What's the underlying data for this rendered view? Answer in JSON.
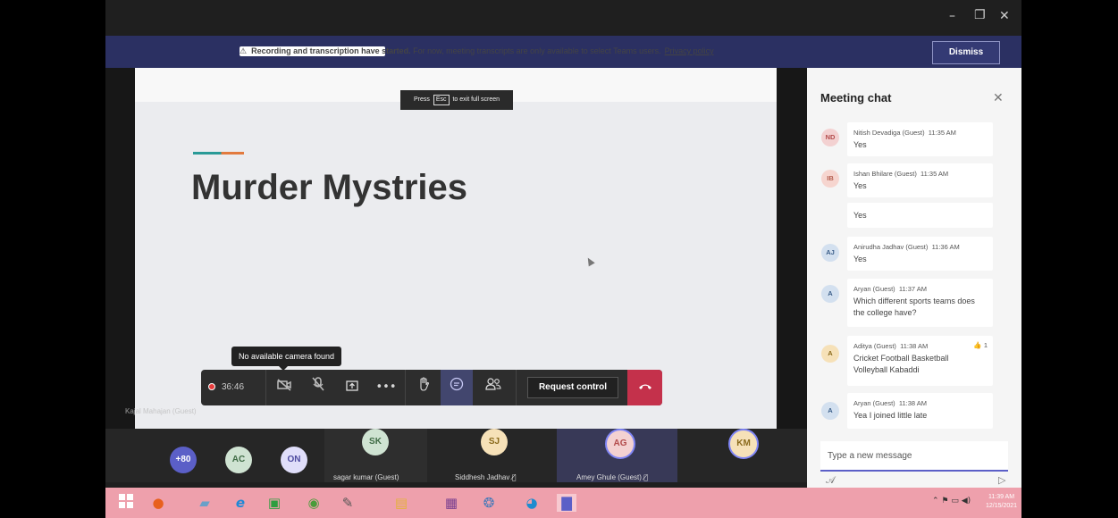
{
  "window": {
    "minimize_glyph": "–",
    "restore_glyph": "❐",
    "close_glyph": "✕"
  },
  "banner": {
    "warning_icon": "⚠",
    "bold_text": "Recording and transcription have started.",
    "text": " For now, meeting transcripts are only available to select Teams users.",
    "link_text": "Privacy policy",
    "dismiss_label": "Dismiss"
  },
  "fullscreen_tip": {
    "before": "Press",
    "key": "Esc",
    "after": "to exit full screen"
  },
  "slide": {
    "title": "Murder Mystries"
  },
  "camera_tooltip": "No available camera found",
  "controls": {
    "timer": "36:46",
    "request_control_label": "Request control",
    "icons": [
      "camera-off-icon",
      "mic-off-icon",
      "share-icon",
      "more-icon",
      "raise-hand-icon",
      "chat-icon",
      "participants-icon",
      "hang-up-icon"
    ]
  },
  "presenter_label": "Kajal Mahajan (Guest)",
  "chat": {
    "title": "Meeting chat",
    "messages": [
      {
        "initials": "ND",
        "sender": "Nitish Devadiga (Guest)",
        "time": "11:35 AM",
        "text": "Yes",
        "avatar_color": "#f3d1d1",
        "text_color": "#b24a4a"
      },
      {
        "initials": "IB",
        "sender": "Ishan Bhilare (Guest)",
        "time": "11:35 AM",
        "text": "Yes",
        "avatar_color": "#f6d5cf",
        "text_color": "#b35d4d"
      },
      {
        "text": "Yes"
      },
      {
        "initials": "AJ",
        "sender": "Anirudha Jadhav (Guest)",
        "time": "11:36 AM",
        "text": "Yes",
        "avatar_color": "#d3e0ef",
        "text_color": "#3c5f8a"
      },
      {
        "initials": "A",
        "sender": "Aryan (Guest)",
        "time": "11:37 AM",
        "text": "Which different sports teams does the college have?",
        "avatar_color": "#d3e0ef",
        "text_color": "#3c5f8a"
      },
      {
        "initials": "A",
        "sender": "Aditya (Guest)",
        "time": "11:38 AM",
        "text": "Cricket Football Basketball Volleyball Kabaddi",
        "avatar_color": "#f6e1b8",
        "text_color": "#8a6a1c",
        "reaction_count": "1"
      },
      {
        "initials": "A",
        "sender": "Aryan (Guest)",
        "time": "11:38 AM",
        "text": "Yea I joined little late",
        "avatar_color": "#d3e0ef",
        "text_color": "#3c5f8a"
      }
    ],
    "compose_placeholder": "Type a new message"
  },
  "participants": [
    {
      "initials": "+80",
      "name": "",
      "color": "#5b5fc7",
      "text_color": "#ffffff"
    },
    {
      "initials": "AC",
      "name": "",
      "color": "#cfe3d2",
      "text_color": "#3f6b45"
    },
    {
      "initials": "ON",
      "name": "",
      "color": "#e0defa",
      "text_color": "#4d4aa0"
    },
    {
      "initials": "SK",
      "name": "sagar kumar (Guest)",
      "color": "#cfe3d2",
      "text_color": "#3f6b45"
    },
    {
      "initials": "SJ",
      "name": "Siddhesh Jadhav",
      "color": "#f6e1b8",
      "text_color": "#8a6a1c"
    },
    {
      "initials": "AG",
      "name": "Amey Ghule (Guest)",
      "color": "#f3d1d1",
      "text_color": "#b24a4a"
    },
    {
      "initials": "KM",
      "name": "",
      "color": "#f6e1b8",
      "text_color": "#8a6a1c"
    }
  ],
  "taskbar": {
    "icons": [
      "windows-start-icon",
      "firefox-icon",
      "notepad-icon",
      "internet-explorer-icon",
      "store-icon",
      "chrome-icon",
      "paint-icon",
      "file-explorer-icon",
      "winrar-icon",
      "people-icon",
      "edge-icon",
      "teams-icon"
    ],
    "clock_time": "11:39 AM",
    "clock_date": "12/15/2021"
  }
}
